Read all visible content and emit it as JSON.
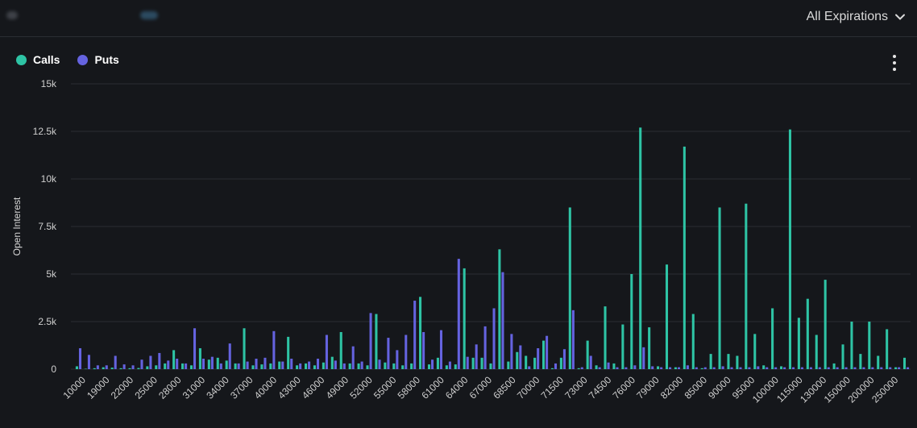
{
  "header": {
    "expiry_label": "All Expirations"
  },
  "menu": {
    "icon": "more-vertical-icon"
  },
  "colors": {
    "calls": "#2ec4a5",
    "puts": "#6563e0",
    "grid": "#2a2d33",
    "background": "#15171b"
  },
  "chart_data": {
    "type": "bar",
    "ylabel": "Open Interest",
    "ylim": [
      0,
      15000
    ],
    "yticks": [
      0,
      2500,
      5000,
      7500,
      10000,
      12500,
      15000
    ],
    "ytick_labels": [
      "0",
      "2.5k",
      "5k",
      "7.5k",
      "10k",
      "12.5k",
      "15k"
    ],
    "xtick_labels": [
      "10000",
      "19000",
      "22000",
      "25000",
      "28000",
      "31000",
      "34000",
      "37000",
      "40000",
      "43000",
      "46000",
      "49000",
      "52000",
      "55000",
      "58000",
      "61000",
      "64000",
      "67000",
      "68500",
      "70000",
      "71500",
      "73000",
      "74500",
      "76000",
      "79000",
      "82000",
      "85000",
      "90000",
      "95000",
      "100000",
      "115000",
      "130000",
      "150000",
      "200000",
      "250000"
    ],
    "categories": [
      "10000",
      "15000",
      "19000",
      "20000",
      "21000",
      "22000",
      "23000",
      "24000",
      "25000",
      "26000",
      "27000",
      "28000",
      "29000",
      "30000",
      "31000",
      "32000",
      "33000",
      "34000",
      "35000",
      "36000",
      "37000",
      "38000",
      "39000",
      "40000",
      "41000",
      "42000",
      "43000",
      "44000",
      "45000",
      "46000",
      "47000",
      "48000",
      "49000",
      "50000",
      "51000",
      "52000",
      "53000",
      "54000",
      "55000",
      "56000",
      "57000",
      "58000",
      "59000",
      "60000",
      "61000",
      "62000",
      "63000",
      "64000",
      "65000",
      "66000",
      "67000",
      "67500",
      "68000",
      "68500",
      "69000",
      "69500",
      "70000",
      "70500",
      "71000",
      "71500",
      "72000",
      "73000",
      "74000",
      "74500",
      "75000",
      "76000",
      "77000",
      "78000",
      "79000",
      "80000",
      "82000",
      "84000",
      "85000",
      "86000",
      "88000",
      "90000",
      "92000",
      "95000",
      "97000",
      "98000",
      "100000",
      "105000",
      "110000",
      "115000",
      "120000",
      "125000",
      "130000",
      "140000",
      "150000",
      "160000",
      "175000",
      "200000",
      "225000",
      "250000",
      "300000"
    ],
    "series": [
      {
        "name": "Calls",
        "values": [
          150,
          20,
          50,
          100,
          80,
          50,
          50,
          60,
          150,
          200,
          300,
          1000,
          300,
          200,
          1100,
          500,
          600,
          450,
          300,
          2150,
          200,
          250,
          300,
          400,
          1700,
          200,
          300,
          200,
          350,
          650,
          1950,
          300,
          300,
          200,
          2900,
          350,
          300,
          200,
          300,
          3800,
          250,
          600,
          200,
          250,
          5300,
          600,
          600,
          300,
          6300,
          400,
          900,
          700,
          600,
          1500,
          50,
          600,
          8500,
          50,
          1500,
          200,
          3300,
          300,
          2350,
          5000,
          12700,
          2200,
          150,
          5500,
          100,
          11700,
          2900,
          50,
          800,
          8500,
          800,
          700,
          8700,
          1850,
          200,
          3200,
          150,
          12600,
          2700,
          3700,
          1800,
          4700,
          300,
          1300,
          2500,
          800,
          2500,
          700,
          2100,
          100,
          600
        ]
      },
      {
        "name": "Puts",
        "values": [
          1100,
          750,
          200,
          200,
          700,
          250,
          200,
          500,
          700,
          850,
          450,
          550,
          300,
          2150,
          550,
          650,
          300,
          1350,
          300,
          400,
          550,
          600,
          2000,
          400,
          550,
          300,
          400,
          550,
          1800,
          450,
          300,
          1200,
          400,
          2950,
          500,
          1650,
          1000,
          1800,
          3600,
          1950,
          500,
          2050,
          400,
          5800,
          650,
          1300,
          2250,
          3200,
          5100,
          1850,
          1250,
          150,
          1100,
          1750,
          300,
          1050,
          3100,
          100,
          700,
          100,
          350,
          100,
          100,
          200,
          1150,
          150,
          100,
          100,
          100,
          200,
          100,
          100,
          100,
          150,
          100,
          100,
          100,
          150,
          100,
          100,
          100,
          100,
          100,
          100,
          100,
          100,
          100,
          100,
          100,
          100,
          100,
          100,
          100,
          100,
          100
        ]
      }
    ],
    "legend": "top-left",
    "grid": true
  }
}
